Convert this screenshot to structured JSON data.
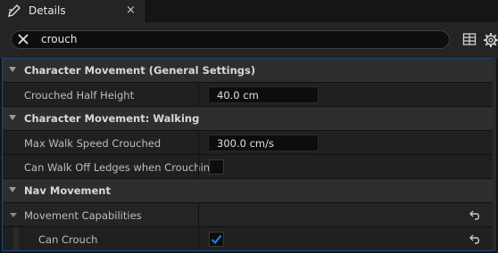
{
  "tab": {
    "title": "Details",
    "close": "×",
    "icon": "pencil-icon"
  },
  "search": {
    "value": "crouch",
    "clear_icon": "close-icon"
  },
  "toolbar": {
    "view_options_icon": "table-view-icon",
    "settings_icon": "gear-icon"
  },
  "categories": [
    {
      "label": "Character Movement (General Settings)",
      "properties": [
        {
          "label": "Crouched Half Height",
          "value": "40.0 cm"
        }
      ]
    },
    {
      "label": "Character Movement: Walking",
      "properties": [
        {
          "label": "Max Walk Speed Crouched",
          "value": "300.0 cm/s"
        },
        {
          "label": "Can Walk Off Ledges when Crouching",
          "checked": false
        }
      ]
    },
    {
      "label": "Nav Movement",
      "subgroup": {
        "label": "Movement Capabilities",
        "properties": [
          {
            "label": "Can Crouch",
            "checked": true
          }
        ]
      }
    }
  ],
  "colors": {
    "accent": "#1e7adf",
    "panel_border": "#1e4a7a",
    "background": "#151515"
  }
}
